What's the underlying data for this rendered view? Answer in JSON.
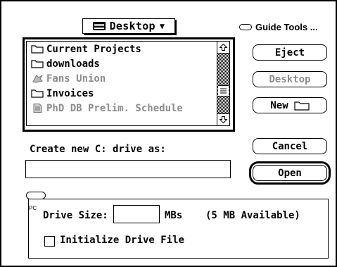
{
  "location_popup": {
    "label": "Desktop",
    "arrow": "▼",
    "icon": "disk-drive-icon"
  },
  "guide": {
    "label": "Guide Tools ...",
    "icon": "balloon-help-icon"
  },
  "files": [
    {
      "name": "Current Projects",
      "icon": "folder-icon",
      "enabled": true
    },
    {
      "name": "downloads",
      "icon": "folder-icon",
      "enabled": true
    },
    {
      "name": "Fans Union",
      "icon": "application-icon",
      "enabled": false
    },
    {
      "name": "Invoices",
      "icon": "folder-icon",
      "enabled": true
    },
    {
      "name": "PhD DB Prelim. Schedule",
      "icon": "document-icon",
      "enabled": false
    }
  ],
  "buttons": {
    "eject": "Eject",
    "desktop": "Desktop",
    "new": "New",
    "cancel": "Cancel",
    "open": "Open"
  },
  "create_label": "Create new C: drive as:",
  "create_value": "",
  "pc_panel": {
    "tag": "PC",
    "drive_size_label": "Drive Size:",
    "drive_size_value": "",
    "units": "MBs",
    "available": "(5 MB Available)",
    "initialize_label": "Initialize Drive File",
    "initialize_checked": false
  }
}
